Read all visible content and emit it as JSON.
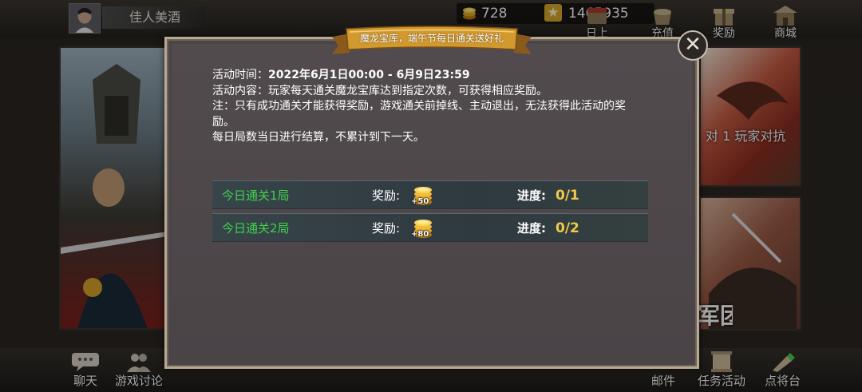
{
  "header": {
    "player_name": "佳人美酒",
    "gold": "728",
    "points": "1465935",
    "buttons": [
      {
        "label": "日上",
        "icon": "daily-icon"
      },
      {
        "label": "充值",
        "icon": "recharge-icon"
      },
      {
        "label": "奖励",
        "icon": "gift-icon"
      },
      {
        "label": "商城",
        "icon": "shop-icon"
      }
    ]
  },
  "background_cards": {
    "right_top_caption": "对 1 玩家对抗",
    "right_bottom_caption": "军团"
  },
  "footer": {
    "buttons": [
      {
        "label": "聊天",
        "icon": "chat-icon"
      },
      {
        "label": "游戏讨论",
        "icon": "discussion-icon"
      },
      {
        "label": "邮件",
        "icon": "mail-icon"
      },
      {
        "label": "任务活动",
        "icon": "task-icon"
      },
      {
        "label": "点将台",
        "icon": "general-icon"
      }
    ]
  },
  "dialog": {
    "title": "魔龙宝库，端午节每日通关送好礼",
    "close_icon": "close-icon",
    "time_label": "活动时间：",
    "time_value": "2022年6月1日00:00 - 6月9日23:59",
    "content": "活动内容：玩家每天通关魔龙宝库达到指定次数，可获得相应奖励。",
    "note": "注：只有成功通关才能获得奖励，游戏通关前掉线、主动退出，无法获得此活动的奖励。",
    "settlement": "每日局数当日进行结算，不累计到下一天。",
    "tasks": [
      {
        "name": "今日通关1局",
        "reward_label": "奖励:",
        "reward_amount": "+50",
        "progress_label": "进度:",
        "progress": "0/1"
      },
      {
        "name": "今日通关2局",
        "reward_label": "奖励:",
        "reward_amount": "+80",
        "progress_label": "进度:",
        "progress": "0/2"
      }
    ]
  },
  "colors": {
    "task_name": "#3fd24a",
    "progress": "#f2c94a",
    "dialog_bg": "#4b4547",
    "dialog_border": "#b7a893"
  }
}
